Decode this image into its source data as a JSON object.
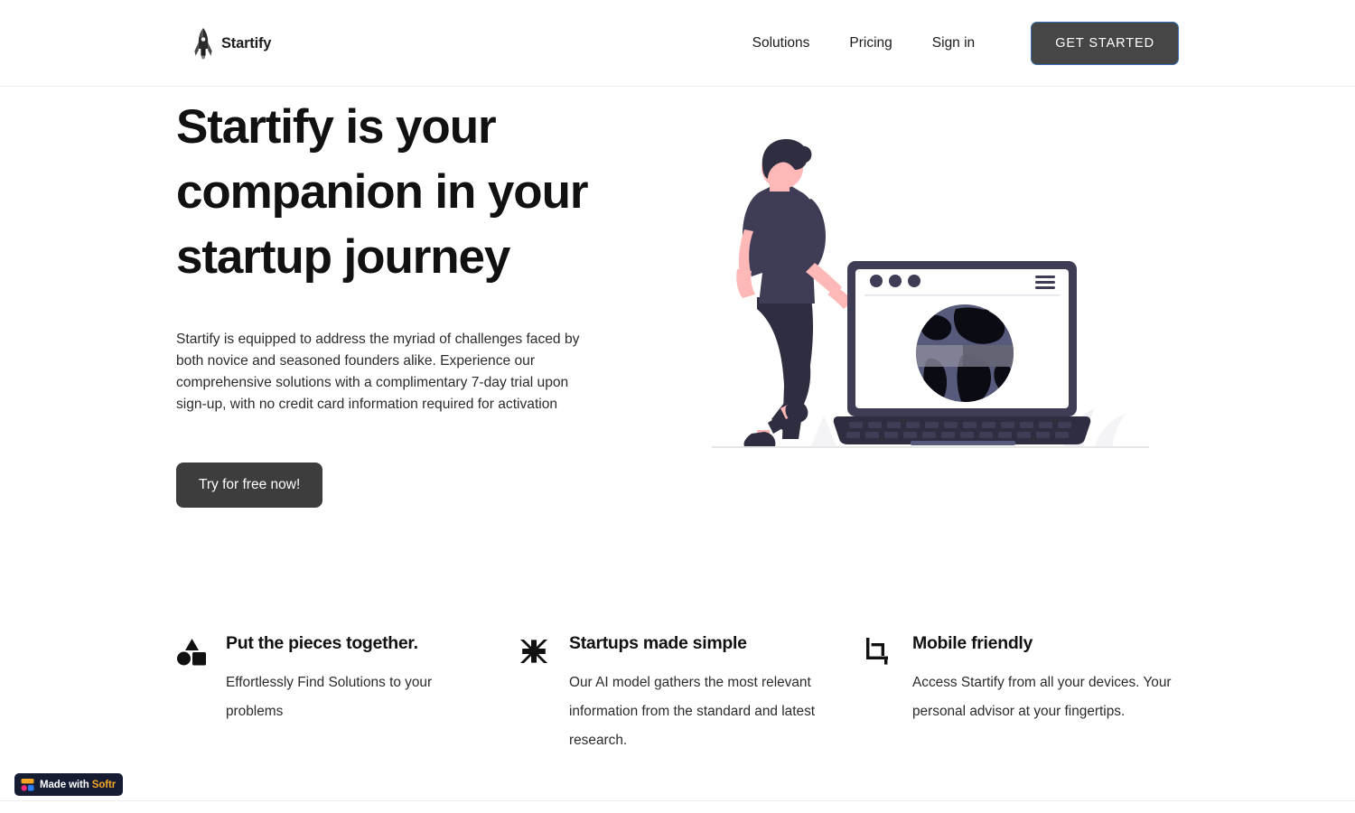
{
  "header": {
    "brand": {
      "name": "Startify",
      "icon": "rocket-icon"
    },
    "nav": [
      {
        "label": "Solutions"
      },
      {
        "label": "Pricing"
      },
      {
        "label": "Sign in"
      }
    ],
    "cta": {
      "label": "GET STARTED",
      "bg": "#464646",
      "border": "#3b6fb0"
    }
  },
  "hero": {
    "title": "Startify is your companion in your startup journey",
    "subtitle": "Startify is equipped to address the myriad of challenges faced by both novice and seasoned founders alike. Experience our comprehensive solutions with a complimentary 7-day trial upon sign-up, with no credit card information required for activation",
    "button": {
      "label": "Try for free now!",
      "bg": "#3d3d3d"
    },
    "illustration": {
      "name": "person-leaning-on-laptop-with-globe",
      "colors": {
        "skin": "#ffb8b8",
        "hair": "#2f2e41",
        "shirt": "#3f3d56",
        "pants": "#2f2e41",
        "laptop": "#3f3d56",
        "globe": "#575a7b",
        "globe_land": "#0b0b14",
        "globe_band": "#8f8f9e"
      }
    }
  },
  "features": [
    {
      "icon": "shapes-icon",
      "title": "Put the pieces together.",
      "text": "Effortlessly Find Solutions to your problems"
    },
    {
      "icon": "minimize-arrows-icon",
      "title": "Startups made simple",
      "text": "Our AI model gathers the most relevant information from the standard and latest research."
    },
    {
      "icon": "crop-icon",
      "title": "Mobile friendly",
      "text": "Access Startify from all your devices. Your personal advisor at your fingertips."
    }
  ],
  "badge": {
    "prefix": "Made with",
    "brand": "Softr",
    "bg": "#151c34",
    "brand_color": "#f5a623",
    "logo_colors": {
      "top": "#f5a623",
      "circle": "#ef2e7a",
      "square": "#2f7df4"
    }
  }
}
